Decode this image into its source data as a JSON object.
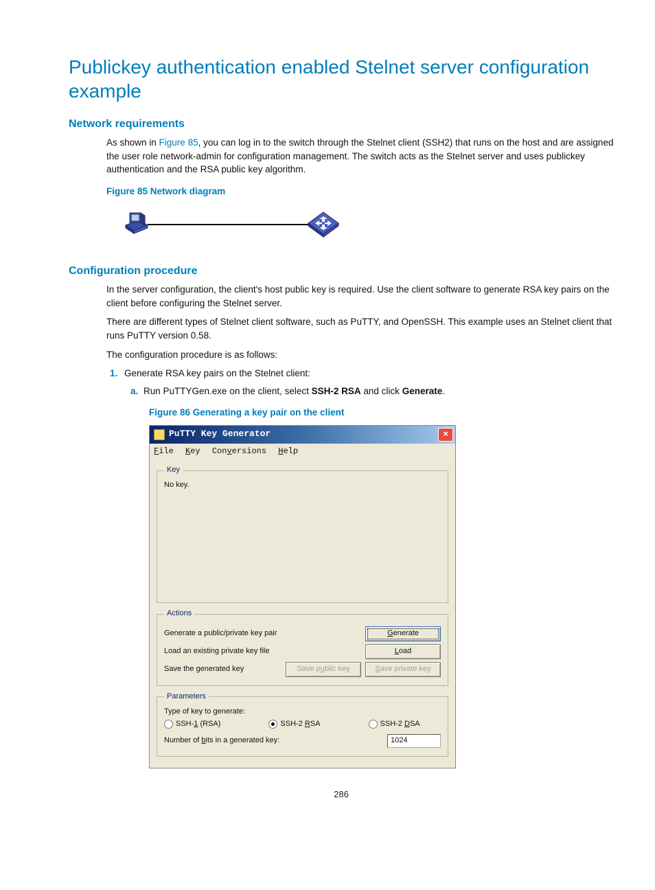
{
  "heading": "Publickey authentication enabled Stelnet server configuration example",
  "sections": {
    "net_req": {
      "title": "Network requirements",
      "para_pre": "As shown in ",
      "fig_link": "Figure 85",
      "para_post": ", you can log in to the switch through the Stelnet client (SSH2) that runs on the host and are assigned the user role network-admin for configuration management. The switch acts as the Stelnet server and uses publickey authentication and the RSA public key algorithm.",
      "fig_caption": "Figure 85 Network diagram"
    },
    "cfg": {
      "title": "Configuration procedure",
      "p1": "In the server configuration, the client's host public key is required. Use the client software to generate RSA key pairs on the client before configuring the Stelnet server.",
      "p2": "There are different types of Stelnet client software, such as PuTTY, and OpenSSH. This example uses an Stelnet client that runs PuTTY version 0.58.",
      "p3": "The configuration procedure is as follows:",
      "step1": "Generate RSA key pairs on the Stelnet client:",
      "step1a_pre": "Run PuTTYGen.exe on the client, select ",
      "step1a_b1": "SSH-2 RSA",
      "step1a_mid": " and click ",
      "step1a_b2": "Generate",
      "step1a_post": ".",
      "fig86_caption": "Figure 86 Generating a key pair on the client"
    }
  },
  "putty": {
    "title": "PuTTY Key Generator",
    "menu": {
      "file": "File",
      "key": "Key",
      "conv": "Conversions",
      "help": "Help"
    },
    "groups": {
      "key": "Key",
      "actions": "Actions",
      "params": "Parameters"
    },
    "key_status": "No key.",
    "actions": {
      "gen_label": "Generate a public/private key pair",
      "gen_btn": "Generate",
      "load_label": "Load an existing private key file",
      "load_btn": "Load",
      "save_label": "Save the generated key",
      "save_pub_btn": "Save public key",
      "save_priv_btn": "Save private key"
    },
    "params": {
      "type_label": "Type of key to generate:",
      "opt1": "SSH-1 (RSA)",
      "opt2": "SSH-2 RSA",
      "opt3": "SSH-2 DSA",
      "bits_label": "Number of bits in a generated key:",
      "bits_value": "1024"
    }
  },
  "page_number": "286"
}
